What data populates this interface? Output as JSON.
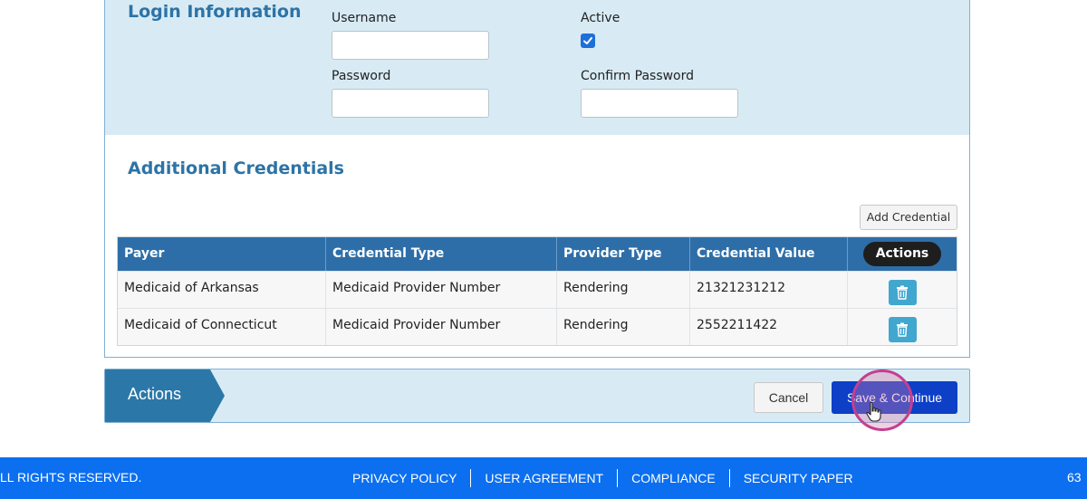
{
  "login": {
    "title": "Login Information",
    "username_label": "Username",
    "username_value": "",
    "password_label": "Password",
    "password_value": "",
    "active_label": "Active",
    "active_checked": true,
    "confirm_password_label": "Confirm Password",
    "confirm_password_value": ""
  },
  "credentials": {
    "title": "Additional Credentials",
    "add_button": "Add Credential",
    "columns": [
      "Payer",
      "Credential Type",
      "Provider Type",
      "Credential Value",
      "Actions"
    ],
    "rows": [
      {
        "payer": "Medicaid of Arkansas",
        "credential_type": "Medicaid Provider Number",
        "provider_type": "Rendering",
        "credential_value": "21321231212"
      },
      {
        "payer": "Medicaid of Connecticut",
        "credential_type": "Medicaid Provider Number",
        "provider_type": "Rendering",
        "credential_value": "2552211422"
      }
    ]
  },
  "actions_bar": {
    "label": "Actions",
    "cancel": "Cancel",
    "save": "Save & Continue"
  },
  "footer": {
    "copyright": "LL RIGHTS RESERVED.",
    "links": [
      "PRIVACY POLICY",
      "USER AGREEMENT",
      "COMPLIANCE",
      "SECURITY PAPER"
    ],
    "right_text": "63"
  },
  "colors": {
    "section_bg": "#d8ebf5",
    "title_blue": "#2d73a6",
    "table_header": "#2e6ea8",
    "primary_button": "#0d3fc7",
    "footer_bg": "#0b6ff0",
    "delete_button": "#41a7cf"
  },
  "icons": {
    "checkbox": "check-icon",
    "delete": "trash-icon",
    "cursor": "hand-pointer-icon"
  }
}
